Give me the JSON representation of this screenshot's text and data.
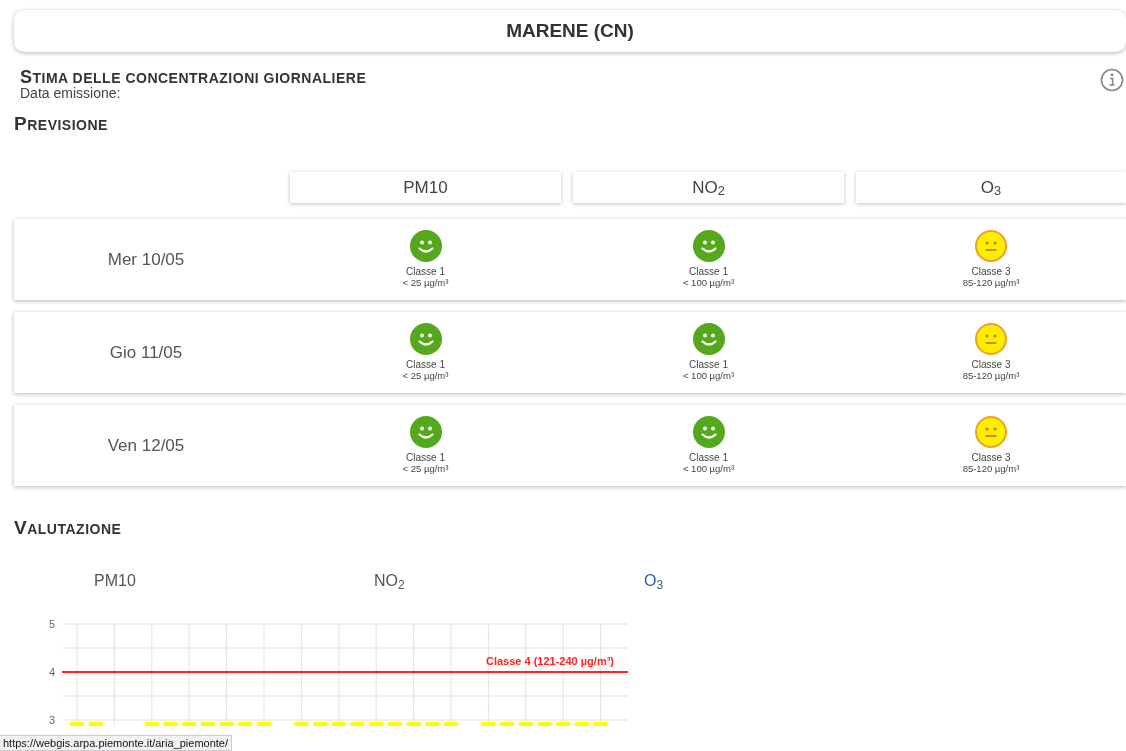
{
  "station": {
    "title": "MARENE (CN)"
  },
  "heading": "STIMA DELLE CONCENTRAZIONI GIORNALIERE",
  "emission": "Data emissione:",
  "forecast": {
    "title": "PREVISIONE",
    "pollutants": [
      "PM10",
      "NO$_{2}$",
      "O$_{3}$"
    ],
    "rows": [
      {
        "date": "Mer 10/05",
        "cells": [
          {
            "kind": "happy",
            "label": "Classe 1",
            "range": "< 25 µg/m³"
          },
          {
            "kind": "happy",
            "label": "Classe 1",
            "range": "< 100 µg/m³"
          },
          {
            "kind": "neutral",
            "label": "Classe 3",
            "range": "85-120 µg/m³"
          }
        ]
      },
      {
        "date": "Gio 11/05",
        "cells": [
          {
            "kind": "happy",
            "label": "Classe 1",
            "range": "< 25 µg/m³"
          },
          {
            "kind": "happy",
            "label": "Classe 1",
            "range": "< 100 µg/m³"
          },
          {
            "kind": "neutral",
            "label": "Classe 3",
            "range": "85-120 µg/m³"
          }
        ]
      },
      {
        "date": "Ven 12/05",
        "cells": [
          {
            "kind": "happy",
            "label": "Classe 1",
            "range": "< 25 µg/m³"
          },
          {
            "kind": "happy",
            "label": "Classe 1",
            "range": "< 100 µg/m³"
          },
          {
            "kind": "neutral",
            "label": "Classe 3",
            "range": "85-120 µg/m³"
          }
        ]
      }
    ]
  },
  "evaluation": {
    "title": "VALUTAZIONE",
    "tabs": [
      {
        "label": "PM10",
        "selected": false
      },
      {
        "label": "NO$_{2}$",
        "selected": false
      },
      {
        "label": "O$_{3}$",
        "selected": true
      }
    ],
    "chart": {
      "kind": "bar",
      "y_labels": [
        "5",
        "4",
        "3"
      ],
      "threshold_label": "Classe 4 (121-240 µg/m³)"
    }
  },
  "status_bar": "https://webgis.arpa.piemonte.it/aria_piemonte/"
}
